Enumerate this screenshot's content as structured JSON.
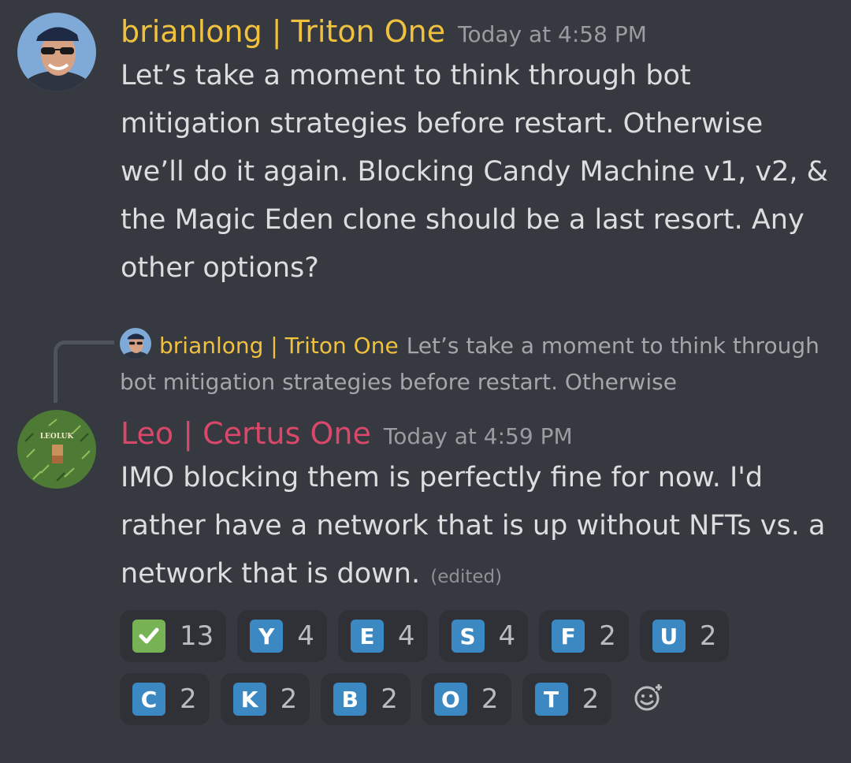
{
  "messages": [
    {
      "author": "brianlong | Triton One",
      "timestamp": "Today at 4:58 PM",
      "content": "Let’s take a moment to think through bot mitigation strategies before restart. Otherwise we’ll do it again. Blocking Candy Machine v1, v2, & the Magic Eden clone should be a last resort. Any other options?",
      "author_color": "#f0c13f"
    },
    {
      "author": "Leo | Certus One",
      "timestamp": "Today at 4:59 PM",
      "content": "IMO blocking them is perfectly fine for now. I'd rather have a network that is up without NFTs vs. a network that is down.",
      "edited_label": "(edited)",
      "author_color": "#d9486a",
      "avatar_text": "LEOLUK"
    }
  ],
  "reply_preview": {
    "author": "brianlong | Triton One",
    "excerpt": "Let’s take a moment to think through bot mitigation strategies before restart. Otherwise"
  },
  "reactions": [
    {
      "emoji": "check-mark-icon",
      "label": "",
      "count": "13"
    },
    {
      "emoji": "letter-y",
      "label": "Y",
      "count": "4"
    },
    {
      "emoji": "letter-e",
      "label": "E",
      "count": "4"
    },
    {
      "emoji": "letter-s",
      "label": "S",
      "count": "4"
    },
    {
      "emoji": "letter-f",
      "label": "F",
      "count": "2"
    },
    {
      "emoji": "letter-u",
      "label": "U",
      "count": "2"
    },
    {
      "emoji": "letter-c",
      "label": "C",
      "count": "2"
    },
    {
      "emoji": "letter-k",
      "label": "K",
      "count": "2"
    },
    {
      "emoji": "letter-b",
      "label": "B",
      "count": "2"
    },
    {
      "emoji": "letter-o",
      "label": "O",
      "count": "2"
    },
    {
      "emoji": "letter-t",
      "label": "T",
      "count": "2"
    }
  ],
  "add_reaction_icon": "add-reaction-icon",
  "colors": {
    "background": "#36393f",
    "reaction_bg": "#2f3136",
    "regional_indicator": "#3b88c3",
    "check": "#77b255"
  }
}
